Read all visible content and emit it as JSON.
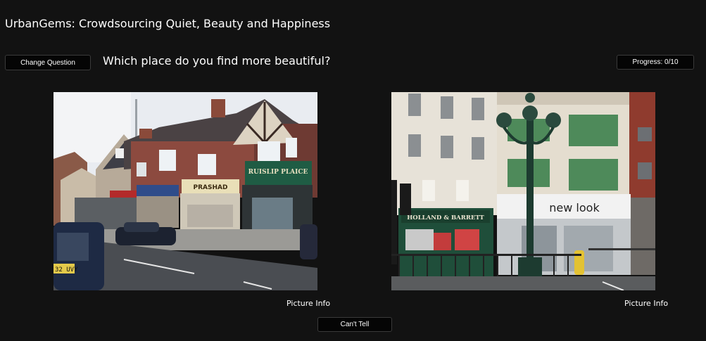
{
  "header": {
    "title": "UrbanGems: Crowdsourcing Quiet, Beauty and Happiness"
  },
  "toolbar": {
    "change_question_label": "Change Question",
    "question": "Which place do you find more beautiful?",
    "progress_label": "Progress: 0/10"
  },
  "images": {
    "left": {
      "shop_signs": [
        "RUISLIP PLAICE",
        "PRASHAD"
      ],
      "plate": "32 UVY"
    },
    "right": {
      "shop_signs": [
        "HOLLAND & BARRETT",
        "new look"
      ]
    }
  },
  "picture_info": {
    "left_label": "Picture Info",
    "right_label": "Picture Info"
  },
  "footer": {
    "cant_tell_label": "Can't Tell"
  },
  "colors": {
    "background": "#121212",
    "button_background": "#050505",
    "button_border": "#3a3a3a",
    "text": "#ffffff"
  }
}
